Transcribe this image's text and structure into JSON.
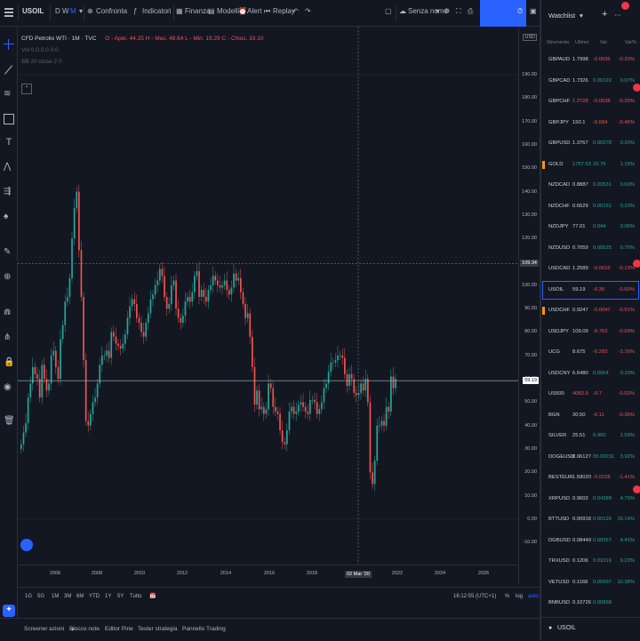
{
  "topbar": {
    "symbol": "USOIL",
    "intervals": [
      "D",
      "W",
      "M"
    ],
    "compare_label": "Confronta",
    "indicators_label": "Indicatori",
    "finance_label": "Finanza",
    "templates_label": "Modelli",
    "alert_label": "Alert",
    "replay_label": "Replay",
    "layout_name": "Senza nome"
  },
  "legend": {
    "title": "CFD Petrolio WTI · 1M · TVC",
    "ohlc": "O - Aper. 44.25  H - Mas. 48.64  L - Min. 19.29  C - Chius. 33.10",
    "line2": "Vol 0.0 0.0 0.0",
    "line3": "BB 20 close 2 0"
  },
  "chart_data": {
    "type": "candlestick",
    "title": "CFD Petrolio WTI",
    "interval": "1M",
    "source": "TVC",
    "xlabel": "",
    "ylabel": "",
    "ylim": [
      -20,
      200
    ],
    "x_ticks": [
      "2006",
      "2008",
      "2010",
      "2012",
      "2014",
      "2016",
      "2018",
      "02 Mar '20",
      "2022",
      "2024",
      "2026"
    ],
    "y_ticks": [
      "190.00",
      "180.00",
      "170.00",
      "160.00",
      "150.00",
      "140.00",
      "130.00",
      "120.00",
      "110.00",
      "100.00",
      "90.00",
      "80.00",
      "70.00",
      "60.00",
      "50.00",
      "40.00",
      "30.00",
      "20.00",
      "10.00",
      "0.00",
      "-10.00"
    ],
    "crosshair_price": "109.34",
    "last_price": "59.19",
    "currency": "USD",
    "series": [
      {
        "close": [
          32,
          37,
          41,
          52,
          58,
          65,
          62,
          60,
          52,
          66,
          60,
          55,
          58,
          70,
          72,
          65,
          60,
          77,
          83,
          93,
          95,
          103,
          120,
          133,
          140,
          115,
          95,
          68,
          42,
          40,
          45,
          50,
          52,
          58,
          66,
          70,
          70,
          72,
          69,
          80,
          78,
          75,
          74,
          73,
          75,
          79,
          86,
          91,
          94,
          92,
          86,
          84,
          80,
          78,
          84,
          88,
          94,
          96,
          100,
          102,
          107,
          104,
          95,
          90,
          92,
          100,
          102,
          90,
          86,
          84,
          87,
          93,
          95,
          93,
          97,
          104,
          106,
          95,
          98,
          95,
          93,
          98,
          100,
          104,
          102,
          100,
          99,
          100,
          102,
          98,
          96,
          99,
          105,
          102,
          103,
          97,
          92,
          86,
          88,
          78,
          65,
          49,
          55,
          47,
          48,
          45,
          47,
          58,
          56,
          48,
          46,
          45,
          38,
          33,
          32,
          38,
          46,
          48,
          45,
          46,
          49,
          50,
          48,
          46,
          45,
          51,
          51,
          50,
          45,
          47,
          50,
          56,
          58,
          63,
          67,
          67,
          68,
          70,
          70,
          69,
          62,
          57,
          62,
          60,
          54,
          53,
          54,
          58,
          55,
          60,
          50,
          20,
          15,
          25,
          40,
          40,
          42,
          40,
          48,
          46,
          61,
          56,
          60
        ]
      }
    ],
    "date_marker": "02 Mar '20"
  },
  "bottombar": {
    "ranges": [
      "1G",
      "5G",
      "1M",
      "3M",
      "6M",
      "YTD",
      "1Y",
      "5Y",
      "Tutto"
    ],
    "time": "16:12:55 (UTC+1)",
    "percent": "%",
    "log": "log",
    "auto": "auto"
  },
  "footer": {
    "tabs": [
      "Screener azioni",
      "Blocco note",
      "Editor Pine",
      "Tester strategia",
      "Pannello Trading"
    ]
  },
  "watchlist": {
    "title": "Watchlist",
    "col_symbol": "Strumento",
    "col_last": "Ultimo",
    "col_chg": "Var",
    "col_pct": "Var%",
    "footer_symbol": "USOIL",
    "rows": [
      {
        "sym": "GBPAUD",
        "last": "1.7998",
        "chg": "-0.0036",
        "pct": "-0.20%",
        "dir": "neg",
        "flag": false
      },
      {
        "sym": "GBPCAD",
        "last": "1.7326",
        "chg": "0.00122",
        "pct": "0.07%",
        "dir": "pos",
        "flag": false
      },
      {
        "sym": "GBPCHF",
        "last": "1.2728",
        "chg": "-0.0038",
        "pct": "-0.29%",
        "dir": "neg",
        "flag": false
      },
      {
        "sym": "GBPJPY",
        "last": "150.1",
        "chg": "-0.684",
        "pct": "-0.45%",
        "dir": "neg",
        "flag": false
      },
      {
        "sym": "GBPUSD",
        "last": "1.3767",
        "chg": "0.00278",
        "pct": "0.20%",
        "dir": "pos",
        "flag": false
      },
      {
        "sym": "GOLD",
        "last": "1757.53",
        "chg": "20.75",
        "pct": "1.19%",
        "dir": "pos",
        "flag": true
      },
      {
        "sym": "NZDCAD",
        "last": "0.8887",
        "chg": "0.00531",
        "pct": "0.60%",
        "dir": "pos",
        "flag": false
      },
      {
        "sym": "NZDCHF",
        "last": "0.6529",
        "chg": "0.00151",
        "pct": "0.23%",
        "dir": "pos",
        "flag": false
      },
      {
        "sym": "NZDJPY",
        "last": "77.01",
        "chg": "0.044",
        "pct": "0.06%",
        "dir": "pos",
        "flag": false
      },
      {
        "sym": "NZDUSD",
        "last": "0.7059",
        "chg": "0.00525",
        "pct": "0.75%",
        "dir": "pos",
        "flag": false
      },
      {
        "sym": "USDCAD",
        "last": "1.2589",
        "chg": "-0.0016",
        "pct": "-0.13%",
        "dir": "neg",
        "flag": false
      },
      {
        "sym": "USOIL",
        "last": "59.19",
        "chg": "-0.36",
        "pct": "-0.60%",
        "dir": "neg",
        "flag": false,
        "selected": true
      },
      {
        "sym": "USDCHF",
        "last": "0.9247",
        "chg": "-0.0047",
        "pct": "-0.51%",
        "dir": "neg",
        "flag": true
      },
      {
        "sym": "USDJPY",
        "last": "109.09",
        "chg": "-0.763",
        "pct": "-0.69%",
        "dir": "neg",
        "flag": false
      },
      {
        "sym": "UCG",
        "last": "8.675",
        "chg": "-0.283",
        "pct": "-3.16%",
        "dir": "neg",
        "flag": false
      },
      {
        "sym": "USDCNY",
        "last": "6.5480",
        "chg": "0.0064",
        "pct": "0.10%",
        "dir": "pos",
        "flag": false
      },
      {
        "sym": "US500",
        "last": "4083.9",
        "chg": "-0.7",
        "pct": "-0.02%",
        "dir": "neg",
        "flag": false
      },
      {
        "sym": "BGN",
        "last": "30.50",
        "chg": "-0.11",
        "pct": "-0.36%",
        "dir": "neg",
        "flag": false
      },
      {
        "sym": "SILVER",
        "last": "25.51",
        "chg": "0.400",
        "pct": "1.59%",
        "dir": "pos",
        "flag": false
      },
      {
        "sym": "DOGEUSD",
        "last": "0.06127",
        "chg": "00.00231",
        "pct": "3.92%",
        "dir": "pos",
        "flag": false
      },
      {
        "sym": "BESTEUR",
        "last": "1.59020",
        "chg": "-0.0228",
        "pct": "-1.41%",
        "dir": "neg",
        "flag": false
      },
      {
        "sym": "XRPUSD",
        "last": "0.9602",
        "chg": "0.04389",
        "pct": "4.79%",
        "dir": "pos",
        "flag": false
      },
      {
        "sym": "BTTUSD",
        "last": "0.00918",
        "chg": "0.00126",
        "pct": "16.14%",
        "dir": "pos",
        "flag": false
      },
      {
        "sym": "DGBUSD",
        "last": "0.08449",
        "chg": "0.00357",
        "pct": "4.41%",
        "dir": "pos",
        "flag": false
      },
      {
        "sym": "TRXUSD",
        "last": "0.1206",
        "chg": "0.01019",
        "pct": "9.23%",
        "dir": "pos",
        "flag": false
      },
      {
        "sym": "VETUSD",
        "last": "0.1168",
        "chg": "0.00997",
        "pct": "10.38%",
        "dir": "pos",
        "flag": false
      },
      {
        "sym": "BNBUSD",
        "last": "0.10726",
        "chg": "0.00858",
        "pct": "",
        "dir": "pos",
        "flag": false
      }
    ]
  }
}
